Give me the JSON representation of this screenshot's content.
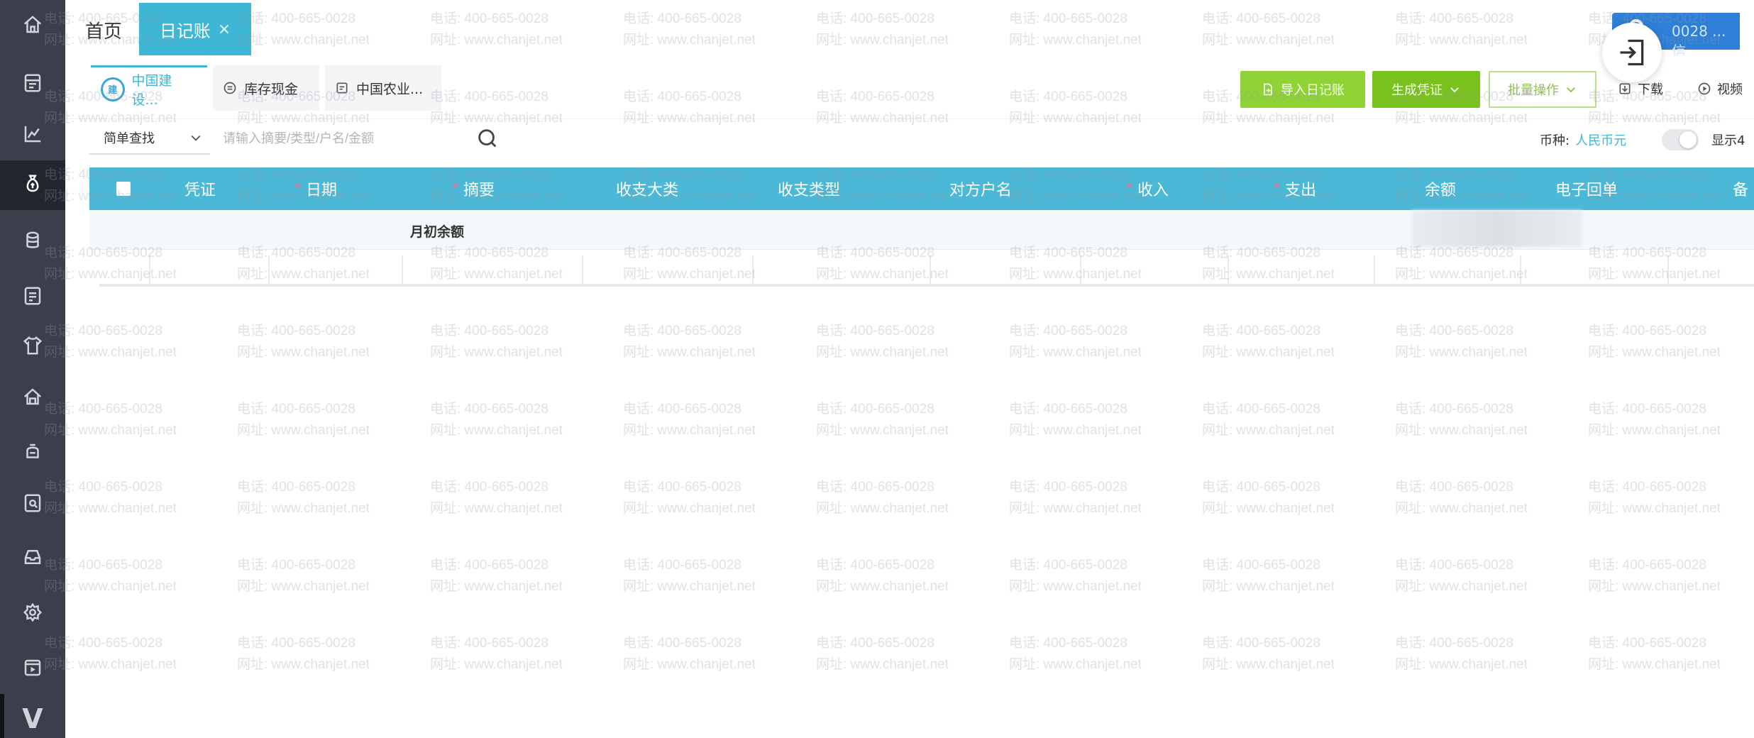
{
  "sidebar": {
    "items": [
      {
        "icon": "home-icon"
      },
      {
        "icon": "ledger-icon"
      },
      {
        "icon": "chart-icon"
      },
      {
        "icon": "money-bag-icon",
        "active": true
      },
      {
        "icon": "coins-icon"
      },
      {
        "icon": "report-icon"
      },
      {
        "icon": "shirt-icon"
      },
      {
        "icon": "house-icon"
      },
      {
        "icon": "piggy-bank-icon"
      },
      {
        "icon": "invoice-icon"
      },
      {
        "icon": "inbox-icon"
      },
      {
        "icon": "settings-icon"
      },
      {
        "icon": "video-icon"
      }
    ],
    "bottom_logo": "V"
  },
  "tabs": {
    "home": "首页",
    "active": "日记账",
    "close": "×"
  },
  "brand": {
    "text": "0028 ...信"
  },
  "accounts": [
    {
      "label": "中国建设...",
      "logo": "建"
    },
    {
      "label": "库存现金"
    },
    {
      "label": "中国农业..."
    }
  ],
  "toolbar": {
    "import": "导入日记账",
    "generate": "生成凭证",
    "batch": "批量操作",
    "download": "下载",
    "video": "视频"
  },
  "search": {
    "mode": "简单查找",
    "placeholder": "请输入摘要/类型/户名/金额"
  },
  "currency": {
    "label": "币种:",
    "value": "人民币元"
  },
  "show_toggle_label": "显示4",
  "table": {
    "columns": [
      "凭证",
      "日期",
      "摘要",
      "收支大类",
      "收支类型",
      "对方户名",
      "收入",
      "支出",
      "余额",
      "电子回单",
      "备"
    ],
    "required": [
      false,
      true,
      true,
      false,
      false,
      false,
      true,
      true,
      false,
      false,
      false
    ],
    "opening_row_label": "月初余额"
  },
  "watermark": {
    "phone": "电话: 400-665-0028",
    "site": "网址: www.chanjet.net"
  },
  "colors": {
    "rail": "#3b3f4b",
    "accent": "#3db7d5",
    "header": "#4ab8d6",
    "green": "#8fd334"
  }
}
